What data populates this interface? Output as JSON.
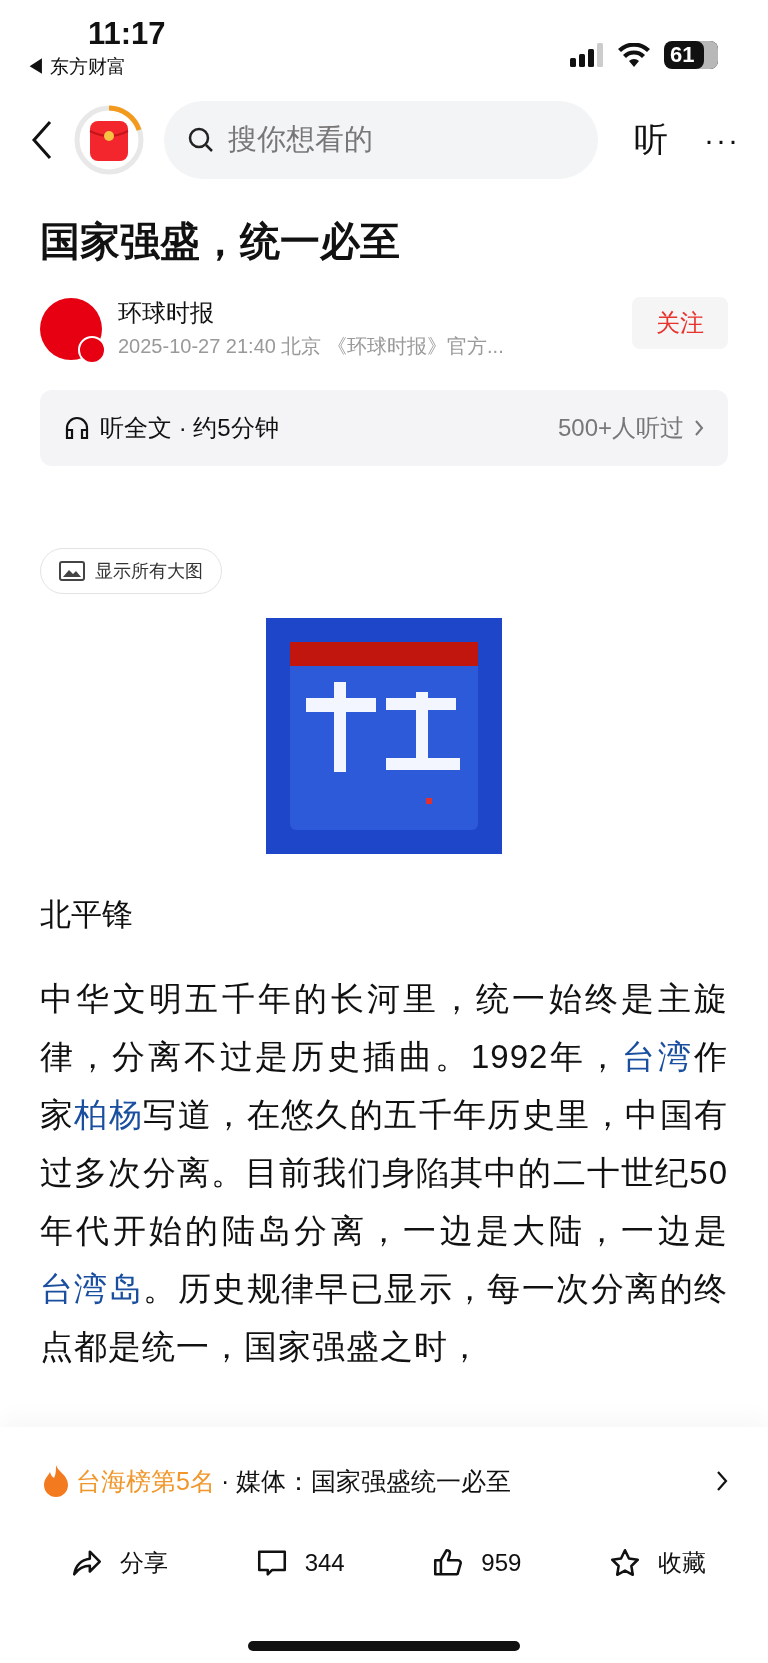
{
  "status_bar": {
    "time": "11:17",
    "back_app": "◀ 东方财富",
    "battery": "61"
  },
  "nav": {
    "search_placeholder": "搜你想看的",
    "listen": "听",
    "more": "···"
  },
  "article": {
    "title": "国家强盛，统一必至",
    "author": {
      "name": "环球时报",
      "meta": "2025-10-27  21:40  北京  《环球时报》官方...",
      "verified": true,
      "follow": "关注"
    },
    "listen_bar": {
      "label": "听全文 · 约5分钟",
      "count": "500+人听过"
    },
    "show_images": "显示所有大图",
    "byline": "北平锋",
    "paragraph": [
      {
        "text": "中华文明五千年的长河里，统一始终是主旋律，分离不过是历史插曲。1992年，",
        "link": false
      },
      {
        "text": "台湾",
        "link": true
      },
      {
        "text": "作家",
        "link": false
      },
      {
        "text": "柏杨",
        "link": true
      },
      {
        "text": "写道，在悠久的五千年历史里，中国有过多次分离。目前我们身陷其中的二十世纪50年代开始的陆岛分离，一边是大陆，一边是",
        "link": false
      },
      {
        "text": "台湾岛",
        "link": true
      },
      {
        "text": "。历史规律早已显示，每一次分离的终点都是统一，国家强盛之时，",
        "link": false
      }
    ]
  },
  "hot": {
    "rank": "台海榜第5名",
    "topic": "· 媒体：国家强盛统一必至"
  },
  "actions": [
    {
      "kind": "share",
      "label": "分享"
    },
    {
      "kind": "comment",
      "label": "344"
    },
    {
      "kind": "like",
      "label": "959"
    },
    {
      "kind": "favorite",
      "label": "收藏"
    }
  ]
}
